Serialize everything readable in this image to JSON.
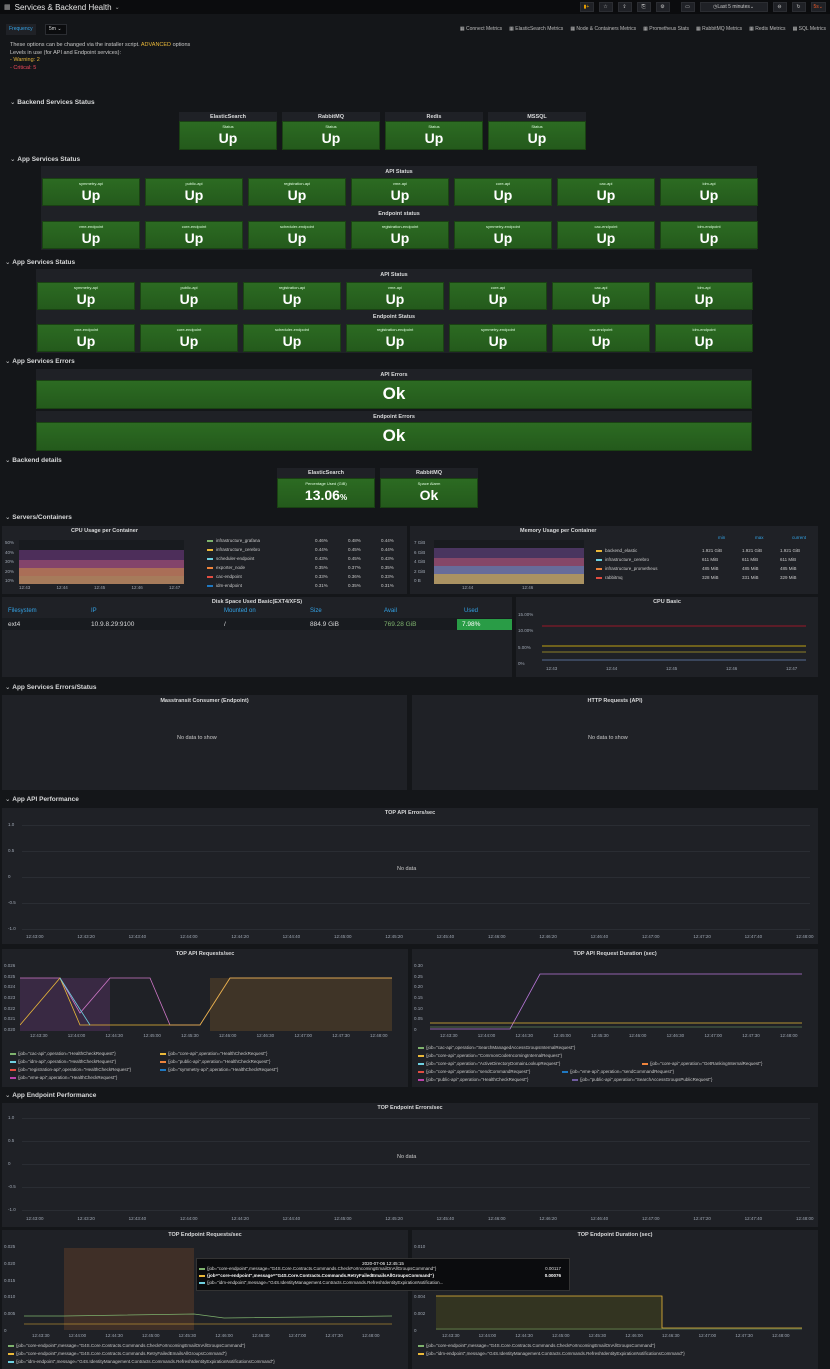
{
  "header": {
    "title": "Services & Backend Health",
    "time_range": "Last 5 minutes",
    "refresh": "5s"
  },
  "variables": {
    "label": "Frequency",
    "value": "5m"
  },
  "links": [
    "Connect Metrics",
    "ElasticSearch Metrics",
    "Node & Containers Metrics",
    "Prometheus Stats",
    "RabbitMQ Metrics",
    "Redis Metrics",
    "SQL Metrics"
  ],
  "info": {
    "line1a": "These options can be changed via the installer script.",
    "line1b": "ADVANCED",
    "line1c": "options",
    "line2": "Levels in use (for API and Endpoint services):",
    "line3": "- Warning: 2",
    "line4": "- Critical: 5"
  },
  "rows": {
    "backend_status": "Backend Services Status",
    "app_status": "App Services Status",
    "app_status2": "App Services Status",
    "app_errors": "App Services Errors",
    "backend_details": "Backend details",
    "servers": "Servers/Containers",
    "errors_status": "App Services Errors/Status",
    "api_perf": "App API Performance",
    "ep_perf": "App Endpoint Performance"
  },
  "backend_stats": [
    {
      "title": "ElasticSearch",
      "label": "Status",
      "value": "Up"
    },
    {
      "title": "RabbitMQ",
      "label": "Status",
      "value": "Up"
    },
    {
      "title": "Redis",
      "label": "Status",
      "value": "Up"
    },
    {
      "title": "MSSQL",
      "label": "Status",
      "value": "Up"
    }
  ],
  "api_status_title": "API Status",
  "endpoint_status_title": "Endpoint status",
  "api1": [
    {
      "label": "symmetry-api",
      "value": "Up"
    },
    {
      "label": "public-api",
      "value": "Up"
    },
    {
      "label": "registration-api",
      "value": "Up"
    },
    {
      "label": "vme-api",
      "value": "Up"
    },
    {
      "label": "core-api",
      "value": "Up"
    },
    {
      "label": "cac-api",
      "value": "Up"
    },
    {
      "label": "idm-api",
      "value": "Up"
    }
  ],
  "ep1": [
    {
      "label": "vme-endpoint",
      "value": "Up"
    },
    {
      "label": "core-endpoint",
      "value": "Up"
    },
    {
      "label": "scheduler-endpoint",
      "value": "Up"
    },
    {
      "label": "registration-endpoint",
      "value": "Up"
    },
    {
      "label": "symmetry-endpoint",
      "value": "Up"
    },
    {
      "label": "cac-endpoint",
      "value": "Up"
    },
    {
      "label": "idm-endpoint",
      "value": "Up"
    }
  ],
  "api_status_title2": "API Status",
  "endpoint_status_title2": "Endpoint Status",
  "api2": [
    {
      "label": "symmetry-api",
      "value": "Up"
    },
    {
      "label": "public-api",
      "value": "Up"
    },
    {
      "label": "registration-api",
      "value": "Up"
    },
    {
      "label": "vme-api",
      "value": "Up"
    },
    {
      "label": "core-api",
      "value": "Up"
    },
    {
      "label": "cac-api",
      "value": "Up"
    },
    {
      "label": "idm-api",
      "value": "Up"
    }
  ],
  "ep2": [
    {
      "label": "vme-endpoint",
      "value": "Up"
    },
    {
      "label": "core-endpoint",
      "value": "Up"
    },
    {
      "label": "scheduler-endpoint",
      "value": "Up"
    },
    {
      "label": "registration-endpoint",
      "value": "Up"
    },
    {
      "label": "symmetry-endpoint",
      "value": "Up"
    },
    {
      "label": "cac-endpoint",
      "value": "Up"
    },
    {
      "label": "idm-endpoint",
      "value": "Up"
    }
  ],
  "errors": {
    "api_title": "API Errors",
    "api_value": "Ok",
    "ep_title": "Endpoint Errors",
    "ep_value": "Ok"
  },
  "details": [
    {
      "title": "ElasticSearch",
      "label": "Percentage Used (GiB)",
      "value": "13.06",
      "unit": "%"
    },
    {
      "title": "RabbitMQ",
      "label": "Space Alarm",
      "value": "Ok",
      "unit": ""
    }
  ],
  "cpu": {
    "title": "CPU Usage per Container",
    "yticks": [
      "50%",
      "40%",
      "30%",
      "20%",
      "10%"
    ],
    "xticks": [
      "12:43",
      "12:44",
      "12:45",
      "12:46",
      "12:47"
    ],
    "legend": [
      {
        "name": "infrastructure_grafana",
        "a": "0.46%",
        "b": "0.48%",
        "c": "0.44%"
      },
      {
        "name": "infrastructure_cerebro",
        "a": "0.44%",
        "b": "0.45%",
        "c": "0.44%"
      },
      {
        "name": "scheduler-endpoint",
        "a": "0.43%",
        "b": "0.45%",
        "c": "0.43%"
      },
      {
        "name": "exporter_node",
        "a": "0.35%",
        "b": "0.37%",
        "c": "0.35%"
      },
      {
        "name": "cac-endpoint",
        "a": "0.33%",
        "b": "0.36%",
        "c": "0.33%"
      },
      {
        "name": "idm-endpoint",
        "a": "0.31%",
        "b": "0.35%",
        "c": "0.31%"
      }
    ]
  },
  "mem": {
    "title": "Memory Usage per Container",
    "yticks": [
      "7 GiB",
      "6 GiB",
      "4 GiB",
      "2 GiB",
      "0 B"
    ],
    "xticks": [
      "12:44",
      "12:46"
    ],
    "cols": [
      "min",
      "max",
      "current"
    ],
    "legend": [
      {
        "name": "backend_elastic",
        "a": "1.921 GiB",
        "b": "1.921 GiB",
        "c": "1.921 GiB"
      },
      {
        "name": "infrastructure_cerebro",
        "a": "611 MiB",
        "b": "611 MiB",
        "c": "611 MiB"
      },
      {
        "name": "infrastructure_prometheus",
        "a": "485 MiB",
        "b": "485 MiB",
        "c": "485 MiB"
      },
      {
        "name": "rabbitmq",
        "a": "328 MiB",
        "b": "331 MiB",
        "c": "329 MiB"
      }
    ]
  },
  "disk": {
    "title": "Disk Space Used Basic(EXT4/XFS)",
    "headers": [
      "Filesystem",
      "IP",
      "Mounted on",
      "Size",
      "Avail",
      "Used"
    ],
    "row": [
      "ext4",
      "10.9.8.29:9100",
      "/",
      "884.9 GiB",
      "769.28 GiB",
      "7.98%"
    ]
  },
  "cpubasic": {
    "title": "CPU Basic",
    "yticks": [
      "15.00%",
      "10.00%",
      "5.00%",
      "0%"
    ],
    "xticks": [
      "12:43",
      "12:44",
      "12:45",
      "12:46",
      "12:47"
    ]
  },
  "es_panels": {
    "left": "Masstransit Consumer (Endpoint)",
    "right": "HTTP Requests (API)",
    "nodata": "No data to show"
  },
  "api_errors": {
    "title": "TOP API Errors/sec",
    "yticks": [
      "1.0",
      "0.5",
      "0",
      "-0.5",
      "-1.0"
    ],
    "nodata": "No data",
    "xticks": [
      "12:43:00",
      "12:43:20",
      "12:43:40",
      "12:44:00",
      "12:44:20",
      "12:44:40",
      "12:45:00",
      "12:45:20",
      "12:45:40",
      "12:46:00",
      "12:46:20",
      "12:46:40",
      "12:47:00",
      "12:47:20",
      "12:47:40",
      "12:48:00"
    ]
  },
  "api_req": {
    "title": "TOP API Requests/sec",
    "yticks": [
      "0.026",
      "0.025",
      "0.024",
      "0.023",
      "0.022",
      "0.021",
      "0.020"
    ],
    "xticks": [
      "12:43:30",
      "12:44:00",
      "12:44:30",
      "12:45:00",
      "12:45:30",
      "12:46:00",
      "12:46:30",
      "12:47:00",
      "12:47:30",
      "12:48:00"
    ],
    "legend": [
      "{job=\"cac-api\",operation=\"HealthCheckRequest\"}",
      "{job=\"core-api\",operation=\"HealthCheckRequest\"}",
      "{job=\"idm-api\",operation=\"HealthCheckRequest\"}",
      "{job=\"public-api\",operation=\"HealthCheckRequest\"}",
      "{job=\"registration-api\",operation=\"HealthCheckRequest\"}",
      "{job=\"symmetry-api\",operation=\"HealthCheckRequest\"}",
      "{job=\"vme-api\",operation=\"HealthCheckRequest\"}"
    ]
  },
  "api_dur": {
    "title": "TOP API Request Duration (sec)",
    "yticks": [
      "0.30",
      "0.25",
      "0.20",
      "0.15",
      "0.10",
      "0.05",
      "0"
    ],
    "xticks": [
      "12:43:30",
      "12:44:00",
      "12:44:30",
      "12:45:00",
      "12:45:30",
      "12:46:00",
      "12:46:30",
      "12:47:00",
      "12:47:30",
      "12:48:00"
    ],
    "legend": [
      "{job=\"cac-api\",operation=\"SearchManagedAccessGroupsInternalRequest\"}",
      "{job=\"core-api\",operation=\"CommonCodeIncomingInternalRequest\"}",
      "{job=\"core-api\",operation=\"ActiveDirectoryDomainLookupRequest\"}",
      "{job=\"core-api\",operation=\"GetRankingInternalRequest\"}",
      "{job=\"core-api\",operation=\"sendCommandRequest\"}",
      "{job=\"vme-api\",operation=\"sendCommandRequest\"}",
      "{job=\"public-api\",operation=\"HealthCheckRequest\"}",
      "{job=\"public-api\",operation=\"SearchAccessGroupsPublicRequest\"}"
    ]
  },
  "ep_errors": {
    "title": "TOP Endpoint Errors/sec",
    "yticks": [
      "1.0",
      "0.5",
      "0",
      "-0.5",
      "-1.0"
    ],
    "nodata": "No data",
    "xticks": [
      "12:43:00",
      "12:43:20",
      "12:43:40",
      "12:44:00",
      "12:44:20",
      "12:44:40",
      "12:45:00",
      "12:45:20",
      "12:45:40",
      "12:46:00",
      "12:46:20",
      "12:46:40",
      "12:47:00",
      "12:47:20",
      "12:47:40",
      "12:48:00"
    ]
  },
  "ep_req": {
    "title": "TOP Endpoint Requests/sec",
    "yticks": [
      "0.025",
      "0.020",
      "0.015",
      "0.010",
      "0.005",
      "0"
    ],
    "xticks": [
      "12:43:30",
      "12:44:00",
      "12:44:30",
      "12:45:00",
      "12:45:30",
      "12:46:00",
      "12:46:30",
      "12:47:00",
      "12:47:30",
      "12:48:00"
    ],
    "legend": [
      "{job=\"core-endpoint\",message=\"G4S.Core.Contracts.Commands.CheckForIncomingEmailOnAllGroupsCommand\"}",
      "{job=\"core-endpoint\",message=\"G4S.Core.Contracts.Commands.RetryFailedEmailsAllGroupsCommand\"}",
      "{job=\"idm-endpoint\",message=\"G4S.IdentityManagement.Contracts.Commands.RefreshIdentityExpirationNotificationsCommand\"}"
    ]
  },
  "tooltip": {
    "time": "2020-07-06 12:45:15",
    "rows": [
      {
        "name": "{job=\"core-endpoint\",message=\"G4S.Core.Contracts.Commands.CheckForIncomingEmailOnAllGroupsCommand\"}",
        "val": "0.00117"
      },
      {
        "name": "{job=\"core-endpoint\",message=\"G4S.Core.Contracts.Commands.RetryFailedEmailsAllGroupsCommand\"}",
        "val": "0.00076"
      },
      {
        "name": "{job=\"idm-endpoint\",message=\"G4S.IdentityManagement.Contracts.Commands.RefreshIdentityExpirationNotification...",
        "val": ""
      }
    ]
  },
  "ep_dur": {
    "title": "TOP Endpoint Duration (sec)",
    "yticks": [
      "0.010",
      "0.008",
      "0.006",
      "0.004",
      "0.002",
      "0"
    ],
    "xticks": [
      "12:43:30",
      "12:44:00",
      "12:44:30",
      "12:45:00",
      "12:45:30",
      "12:46:00",
      "12:46:30",
      "12:47:00",
      "12:47:30",
      "12:48:00"
    ],
    "legend": [
      "{job=\"core-endpoint\",message=\"G4S.Core.Contracts.Commands.CheckForIncomingEmailOnAllGroupsCommand\"}",
      "{job=\"idm-endpoint\",message=\"G4S.IdentityManagement.Contracts.Commands.RefreshIdentityExpirationNotificationsCommand\"}"
    ]
  },
  "colors": {
    "green": "#2c6b22",
    "accent": "#33a2e5",
    "warn": "#eab839",
    "crit": "#f2495c"
  }
}
